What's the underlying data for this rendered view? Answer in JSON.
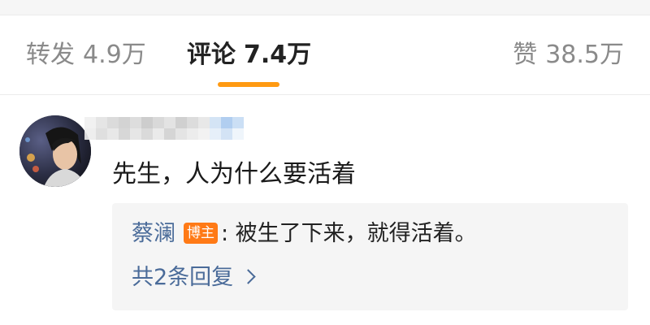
{
  "tabs": {
    "repost": {
      "label": "转发",
      "count": "4.9万"
    },
    "comments": {
      "label": "评论",
      "count": "7.4万"
    },
    "likes": {
      "label": "赞",
      "count": "38.5万"
    }
  },
  "colors": {
    "accent": "#ff9a12",
    "link": "#4a6b99",
    "badge": "#ff7a16",
    "reply_bg": "#f5f5f5"
  },
  "comment": {
    "text": "先生，人为什么要活着",
    "reply": {
      "author": "蔡澜",
      "badge": "博主",
      "text": ": 被生了下来，就得活着。"
    },
    "more_replies": "共2条回复"
  },
  "icons": {
    "more_replies": "chevron-right-icon"
  }
}
